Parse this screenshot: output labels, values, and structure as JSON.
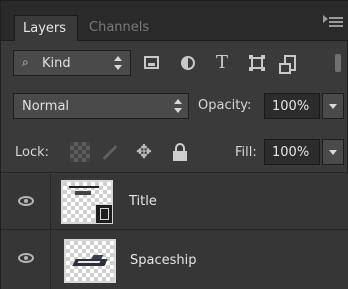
{
  "tabs": [
    {
      "label": "Layers",
      "active": true
    },
    {
      "label": "Channels",
      "active": false
    }
  ],
  "panel_menu_icon": "panel-menu-icon",
  "filter": {
    "search_icon": "search-icon",
    "kind_label": "Kind",
    "filter_icons": [
      "pixel-layer-filter-icon",
      "adjustment-layer-filter-icon",
      "type-layer-filter-icon",
      "shape-layer-filter-icon",
      "smart-object-filter-icon"
    ],
    "type_glyph": "T"
  },
  "blend": {
    "mode": "Normal",
    "opacity_label": "Opacity:",
    "opacity_value": "100%"
  },
  "lock": {
    "label": "Lock:",
    "icons": [
      "lock-transparent-pixels-icon",
      "lock-image-pixels-icon",
      "lock-position-icon",
      "lock-all-icon"
    ],
    "fill_label": "Fill:",
    "fill_value": "100%"
  },
  "layers": [
    {
      "name": "Title",
      "visible": true,
      "smart_object": true
    },
    {
      "name": "Spaceship",
      "visible": true,
      "smart_object": false
    }
  ],
  "colors": {
    "panel_bg": "#3a3a3a",
    "tab_bar_bg": "#2a2a2a",
    "field_bg": "#2c2c2c"
  }
}
